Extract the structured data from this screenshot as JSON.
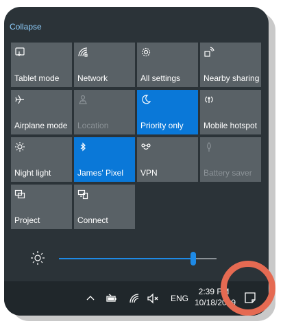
{
  "action_center": {
    "collapse_label": "Collapse",
    "tiles": [
      {
        "label": "Tablet mode",
        "icon": "tablet-mode-icon",
        "state": "off"
      },
      {
        "label": "Network",
        "icon": "network-icon",
        "state": "off"
      },
      {
        "label": "All settings",
        "icon": "gear-icon",
        "state": "off"
      },
      {
        "label": "Nearby sharing",
        "icon": "nearby-sharing-icon",
        "state": "off"
      },
      {
        "label": "Airplane mode",
        "icon": "airplane-icon",
        "state": "off"
      },
      {
        "label": "Location",
        "icon": "location-icon",
        "state": "disabled"
      },
      {
        "label": "Priority only",
        "icon": "moon-icon",
        "state": "on"
      },
      {
        "label": "Mobile hotspot",
        "icon": "mobile-hotspot-icon",
        "state": "off"
      },
      {
        "label": "Night light",
        "icon": "night-light-icon",
        "state": "off"
      },
      {
        "label": "James' Pixel",
        "icon": "bluetooth-icon",
        "state": "on"
      },
      {
        "label": "VPN",
        "icon": "vpn-icon",
        "state": "off"
      },
      {
        "label": "Battery saver",
        "icon": "battery-saver-icon",
        "state": "disabled"
      },
      {
        "label": "Project",
        "icon": "project-icon",
        "state": "off"
      },
      {
        "label": "Connect",
        "icon": "connect-icon",
        "state": "off"
      }
    ],
    "brightness_percent": 85
  },
  "taskbar": {
    "language": "ENG",
    "time": "2:39 PM",
    "date": "10/18/2019",
    "icons": [
      "chevron-up-icon",
      "battery-icon",
      "wifi-icon",
      "volume-muted-icon",
      "notifications-icon"
    ]
  },
  "colors": {
    "accent": "#0a78d8",
    "panel": "#2b3338",
    "tile": "#596166",
    "taskbar": "#20272b",
    "highlight_ring": "#e56a52"
  }
}
